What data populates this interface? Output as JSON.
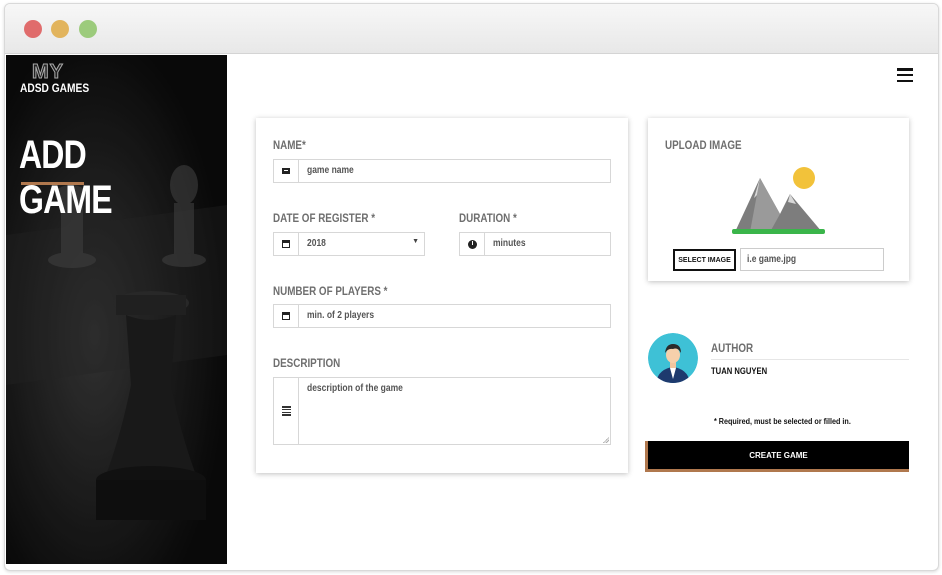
{
  "brand": {
    "logo_top": "MY",
    "logo_sub": "ADSD GAMES"
  },
  "page": {
    "title": "ADD GAME"
  },
  "form": {
    "name_label": "NAME",
    "name_required": "*",
    "name_placeholder": "game name",
    "date_label": "DATE OF REGISTER",
    "date_required": "*",
    "date_value": "2018",
    "duration_label": "DURATION",
    "duration_required": "*",
    "duration_placeholder": "minutes",
    "players_label": "NUMBER OF PLAYERS",
    "players_required": "*",
    "players_placeholder": "min. of 2 players",
    "description_label": "DESCRIPTION",
    "description_placeholder": "description of the game"
  },
  "upload": {
    "title": "UPLOAD IMAGE",
    "select_button": "SELECT IMAGE",
    "filename_placeholder": "i.e game.jpg"
  },
  "author": {
    "label": "AUTHOR",
    "name": "TUAN NGUYEN"
  },
  "required_note": "* Required, must be selected or filled in.",
  "create_button": "CREATE GAME",
  "colors": {
    "accent": "#b0784e",
    "sidebar_bg": "#0d0d0d",
    "button_bg": "#000000"
  },
  "icons": {
    "menu": "hamburger-icon",
    "name": "id-card-icon",
    "date": "calendar-icon",
    "duration": "clock-icon",
    "players": "calendar-icon",
    "description": "align-justify-icon"
  }
}
